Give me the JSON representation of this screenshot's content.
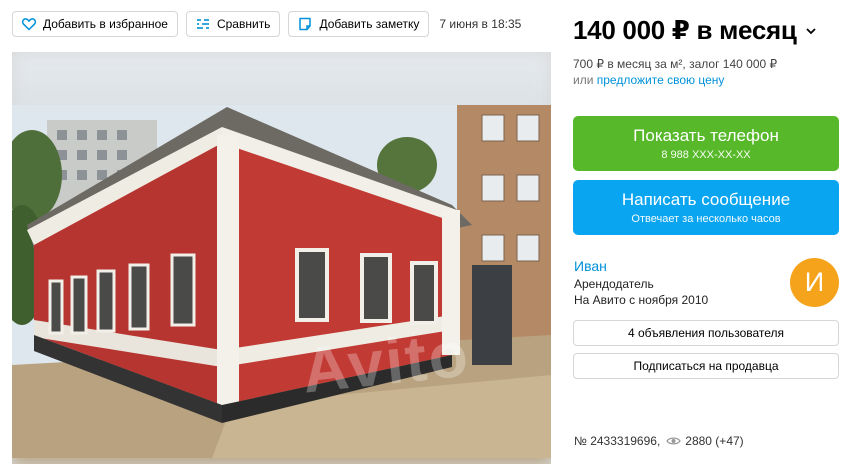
{
  "toolbar": {
    "favorite_label": "Добавить в избранное",
    "compare_label": "Сравнить",
    "note_label": "Добавить заметку",
    "date": "7 июня в 18:35"
  },
  "watermark": "Avito",
  "price": {
    "main": "140 000 ₽ в месяц",
    "details": "700 ₽ в месяц за м², залог 140 000 ₽",
    "offer_prefix": "или ",
    "offer_link": "предложите свою цену"
  },
  "actions": {
    "phone_title": "Показать телефон",
    "phone_masked": "8 988 XXX-XX-XX",
    "message_title": "Написать сообщение",
    "message_sub": "Отвечает за несколько часов"
  },
  "seller": {
    "name": "Иван",
    "role": "Арендодатель",
    "since": "На Авито с ноября 2010",
    "avatar_letter": "И",
    "ads_button": "4 объявления пользователя",
    "subscribe_button": "Подписаться на продавца"
  },
  "listing": {
    "number": "№ 2433319696,",
    "views": "2880 (+47)"
  },
  "colors": {
    "green": "#57b92a",
    "blue": "#0aa5f0",
    "link": "#0091d9",
    "avatar": "#f6a31c"
  },
  "icons": [
    "heart-icon",
    "compare-icon",
    "note-icon",
    "chevron-down-icon",
    "eye-icon"
  ]
}
